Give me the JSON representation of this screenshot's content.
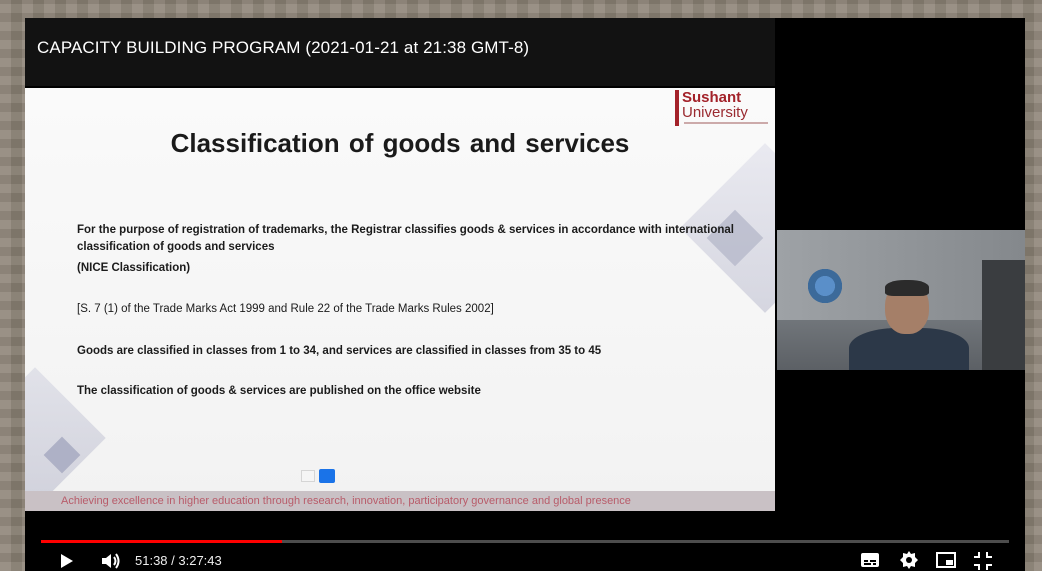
{
  "player": {
    "title": "CAPACITY BUILDING PROGRAM (2021-01-21 at 21:38 GMT-8)",
    "time_display": "51:38 / 3:27:43",
    "progress": 0.2486,
    "accent_color": "#ff0000"
  },
  "slide": {
    "logo_top": "Sushant",
    "logo_bottom": "University",
    "title": "Classification of goods  and services",
    "paragraph1": "For the purpose of registration of trademarks, the Registrar classifies goods & services in accordance with international classification of goods and services",
    "paragraph2": "(NICE Classification)",
    "paragraph3": "[S. 7 (1) of the Trade Marks Act 1999 and Rule 22 of the Trade Marks Rules 2002]",
    "paragraph4": "Goods are classified in classes from 1 to 34, and services are classified in classes from 35 to 45",
    "paragraph5": "The  classification of goods & services are published on the office website",
    "footer": "Achieving excellence in higher education through research, innovation, participatory governance and global presence"
  },
  "icons": {
    "play": "play-icon",
    "volume": "volume-icon",
    "subtitles": "subtitles-icon",
    "settings": "settings-icon",
    "miniplayer": "miniplayer-icon",
    "fullscreen": "fullscreen-icon"
  }
}
